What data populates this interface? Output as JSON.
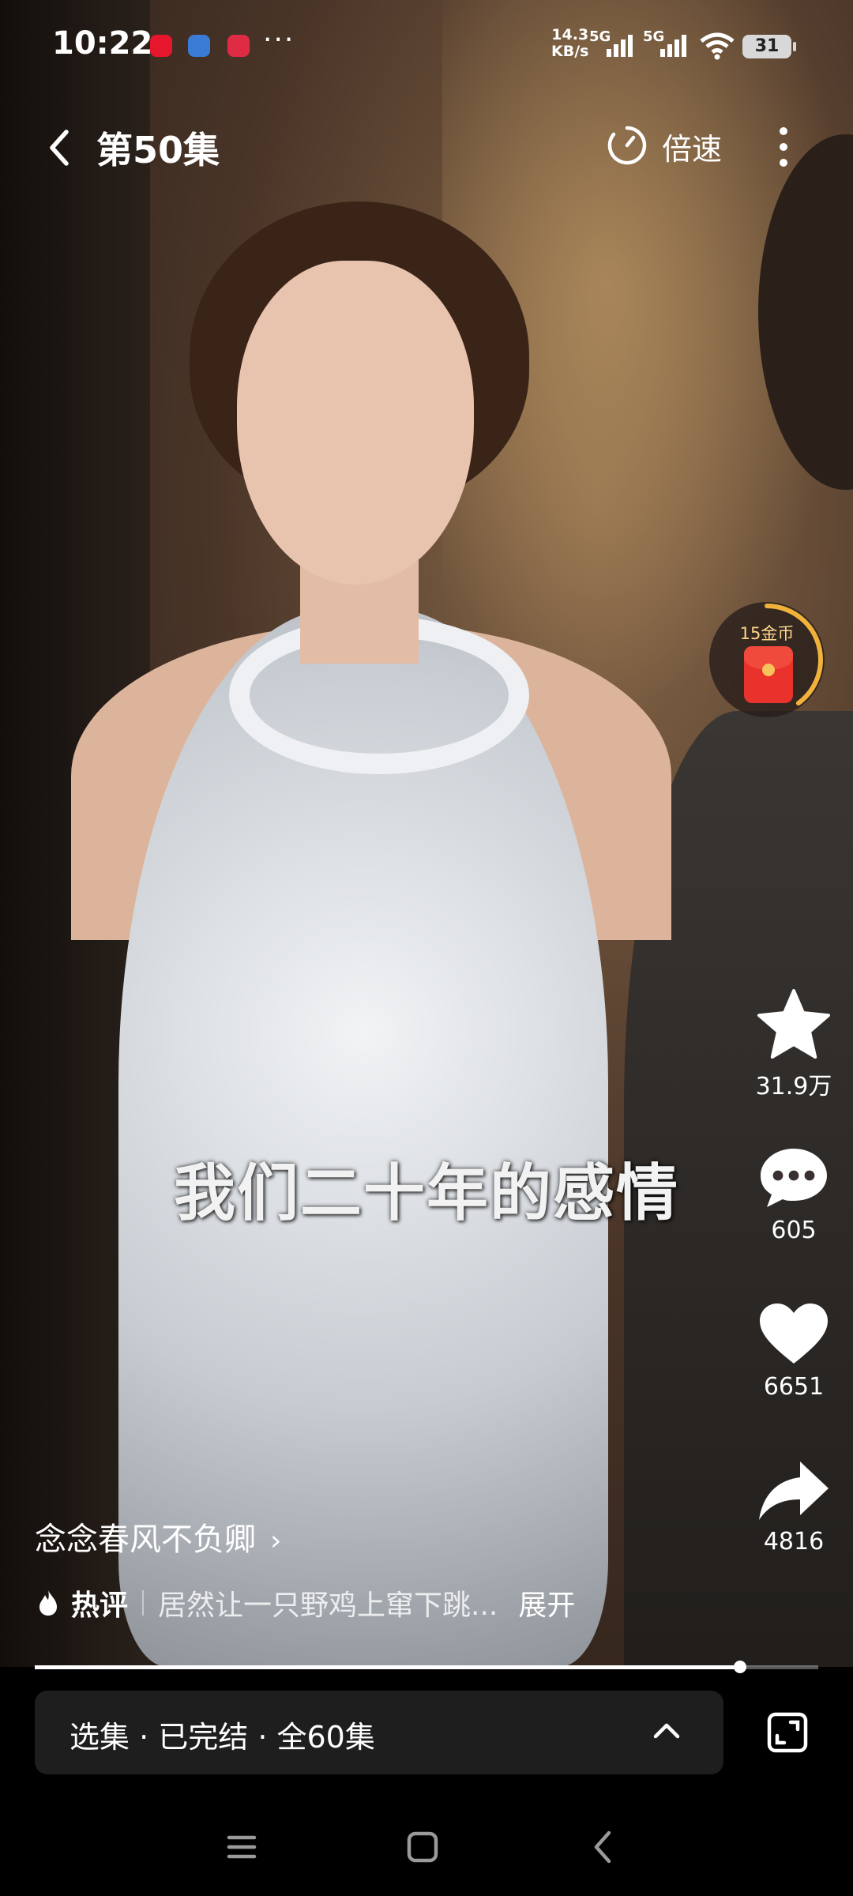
{
  "status_bar": {
    "time": "10:22",
    "app_icons": [
      {
        "name": "weibo-icon",
        "color": "#e6162d"
      },
      {
        "name": "app-icon",
        "color": "#3a7bd5"
      },
      {
        "name": "video-app-icon",
        "color": "#e02b45"
      }
    ],
    "more": "···",
    "net_speed_value": "14.3",
    "net_speed_unit": "KB/s",
    "sim1_label": "5G",
    "sim2_label": "5G",
    "battery": "31"
  },
  "top_bar": {
    "episode_title": "第50集",
    "speed_label": "倍速"
  },
  "reward": {
    "coins_label": "15金币",
    "progress": 0.4
  },
  "actions": {
    "favorite_count": "31.9万",
    "comment_count": "605",
    "like_count": "6651",
    "share_count": "4816"
  },
  "video": {
    "subtitle": "我们二十年的感情",
    "progress": 0.9
  },
  "info": {
    "drama_title": "念念春风不负卿",
    "drama_chevron": "›",
    "hot_comment_label": "热评",
    "hot_comment_text": "居然让一只野鸡上窜下跳...",
    "expand_label": "展开"
  },
  "episodes_bar": {
    "label": "选集 · 已完结 · 全60集"
  }
}
